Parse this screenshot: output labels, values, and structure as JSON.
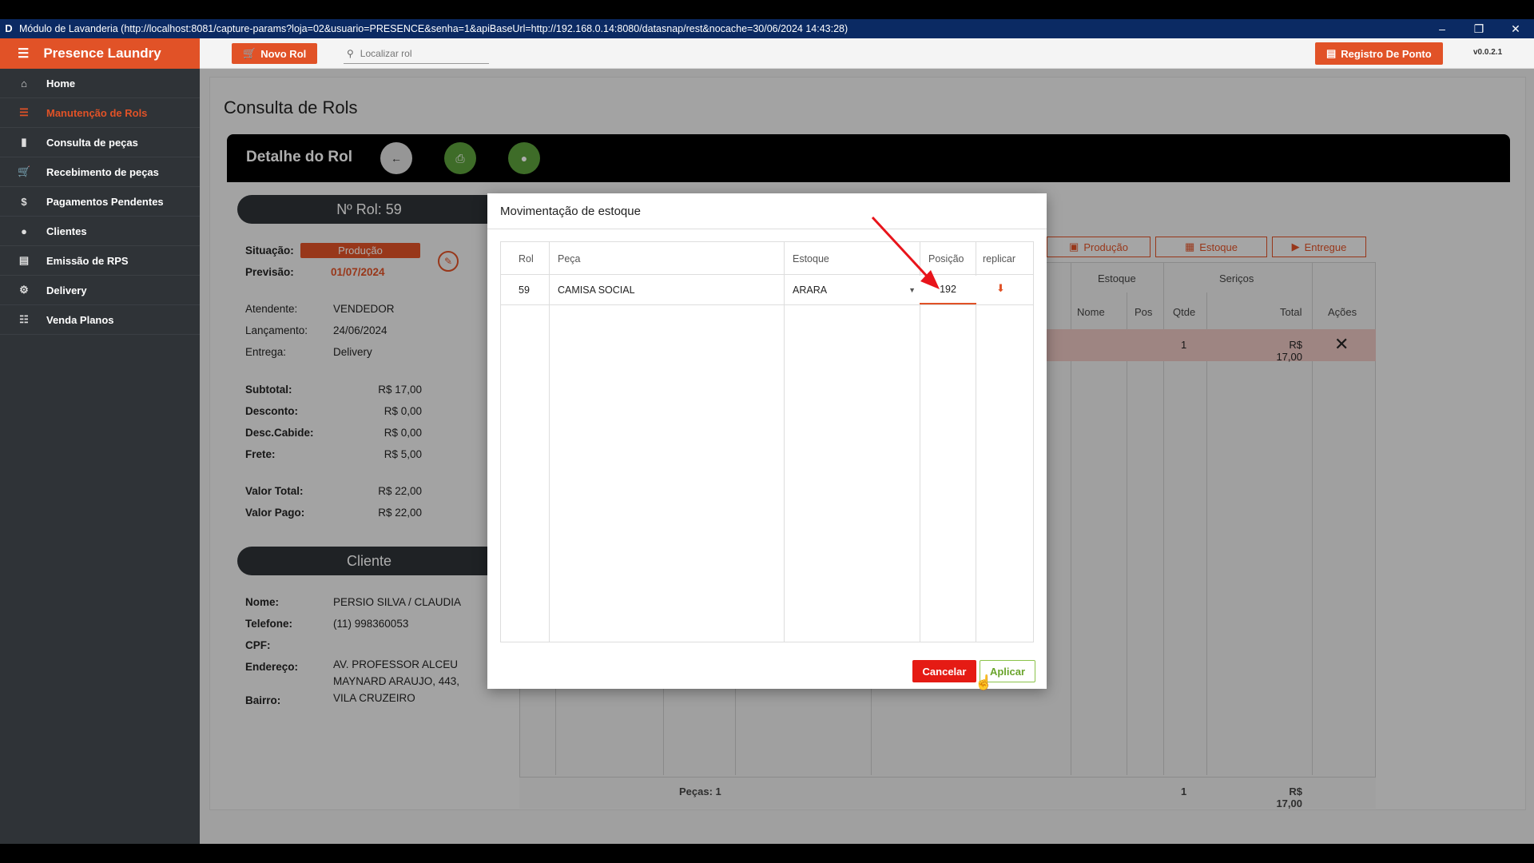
{
  "window": {
    "title": "Módulo de Lavanderia (http://localhost:8081/capture-params?loja=02&usuario=PRESENCE&senha=1&apiBaseUrl=http://192.168.0.14:8080/datasnap/rest&nocache=30/06/2024 14:43:28)",
    "icon_letter": "D"
  },
  "sidebar": {
    "brand": "Presence Laundry",
    "items": [
      {
        "label": "Home",
        "icon": "home-icon"
      },
      {
        "label": "Manutenção de Rols",
        "icon": "list-icon",
        "active": true
      },
      {
        "label": "Consulta de peças",
        "icon": "tag-icon"
      },
      {
        "label": "Recebimento de peças",
        "icon": "cart-icon"
      },
      {
        "label": "Pagamentos Pendentes",
        "icon": "dollar-icon"
      },
      {
        "label": "Clientes",
        "icon": "user-icon"
      },
      {
        "label": "Emissão de RPS",
        "icon": "document-icon"
      },
      {
        "label": "Delivery",
        "icon": "delivery-icon"
      },
      {
        "label": "Venda Planos",
        "icon": "plan-icon"
      }
    ]
  },
  "topbar": {
    "novo_rol": "Novo Rol",
    "search_placeholder": "Localizar rol",
    "registro": "Registro De Ponto",
    "version": "v0.0.2.1"
  },
  "page": {
    "title": "Consulta de Rols",
    "detail_title": "Detalhe do Rol"
  },
  "rol": {
    "pill": "Nº Rol: 59",
    "situacao_label": "Situação:",
    "situacao": "Produção",
    "previsao_label": "Previsão:",
    "previsao": "01/07/2024",
    "atendente_label": "Atendente:",
    "atendente": "VENDEDOR",
    "lancamento_label": "Lançamento:",
    "lancamento": "24/06/2024",
    "entrega_label": "Entrega:",
    "entrega": "Delivery",
    "subtotal_label": "Subtotal:",
    "subtotal": "R$ 17,00",
    "desconto_label": "Desconto:",
    "desconto": "R$ 0,00",
    "desc_cabide_label": "Desc.Cabide:",
    "desc_cabide": "R$ 0,00",
    "frete_label": "Frete:",
    "frete": "R$ 5,00",
    "valor_total_label": "Valor Total:",
    "valor_total": "R$ 22,00",
    "valor_pago_label": "Valor Pago:",
    "valor_pago": "R$ 22,00"
  },
  "cliente": {
    "pill": "Cliente",
    "nome_label": "Nome:",
    "nome": "PERSIO SILVA / CLAUDIA",
    "telefone_label": "Telefone:",
    "telefone": "(11) 998360053",
    "cpf_label": "CPF:",
    "cpf": "",
    "endereco_label": "Endereço:",
    "endereco_1": "AV. PROFESSOR ALCEU",
    "endereco_2": "MAYNARD ARAUJO, 443,",
    "endereco_3": "VILA CRUZEIRO",
    "bairro_label": "Bairro:"
  },
  "bg_table": {
    "status_buttons": [
      "Produção",
      "Estoque",
      "Entregue"
    ],
    "group_estoque": "Estoque",
    "group_servicos": "Seriços",
    "col_nome": "Nome",
    "col_pos": "Pos",
    "col_qtde": "Qtde",
    "col_total": "Total",
    "col_acoes": "Ações",
    "row_qtde": "1",
    "row_total": "R$ 17,00",
    "footer_pecas": "Peças: 1",
    "footer_qtde": "1",
    "footer_total": "R$ 17,00"
  },
  "modal": {
    "title": "Movimentação de estoque",
    "headers": [
      "Rol",
      "Peça",
      "Estoque",
      "Posição",
      "replicar"
    ],
    "row": {
      "rol": "59",
      "peca": "CAMISA SOCIAL",
      "estoque": "ARARA",
      "posicao": "192"
    },
    "cancel": "Cancelar",
    "apply": "Aplicar"
  },
  "colors": {
    "accent": "#e15227",
    "sidebar": "#2f3337",
    "success": "#5c9f3b",
    "danger": "#e51b14",
    "annotation_arrow": "#e8141b"
  }
}
